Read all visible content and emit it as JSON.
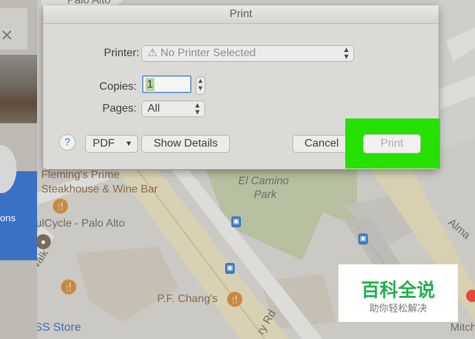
{
  "map": {
    "labels": {
      "top_street": "Palo Alto",
      "flemings_1": "Fleming's Prime",
      "flemings_2": "Steakhouse & Wine Bar",
      "el_camino_1": "El Camino",
      "el_camino_2": "Park",
      "soulcycle": "ulCycle - Palo Alto",
      "walk": "Walk",
      "pf_changs": "P.F. Chang's",
      "store": "SS Store",
      "ry_rd": "ry Rd",
      "alma": "Alma",
      "mitch": "Mitch"
    },
    "left_panel_text": "ons",
    "close_glyph": "×"
  },
  "dialog": {
    "title": "Print",
    "printer_label": "Printer:",
    "printer_value": "⚠ No Printer Selected",
    "copies_label": "Copies:",
    "copies_value": "1",
    "pages_label": "Pages:",
    "pages_value": "All",
    "help_label": "?",
    "pdf_label": "PDF",
    "show_details_label": "Show Details",
    "cancel_label": "Cancel",
    "print_label": "Print",
    "highlight_color": "#26e000"
  },
  "watermark": {
    "main": "百科全说",
    "sub": "助你轻松解决"
  }
}
